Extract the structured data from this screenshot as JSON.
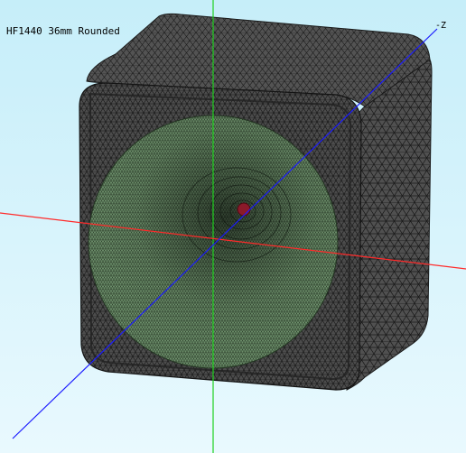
{
  "viewport": {
    "model_title": "HF1440 36mm Rounded",
    "axis_label": "-Z"
  },
  "colors": {
    "background_top": "#c6eef9",
    "background_bottom": "#e9f9fe",
    "mesh_shell": "#4a4a4a",
    "mesh_lines": "#1a1a1a",
    "horn_mouth": "#6d8f6b",
    "throat_marker": "#8b1a2a",
    "x_axis": "#ff2a2a",
    "y_axis": "#1fd11f",
    "z_axis": "#1a1aff"
  },
  "icons": [
    "throat-marker"
  ]
}
